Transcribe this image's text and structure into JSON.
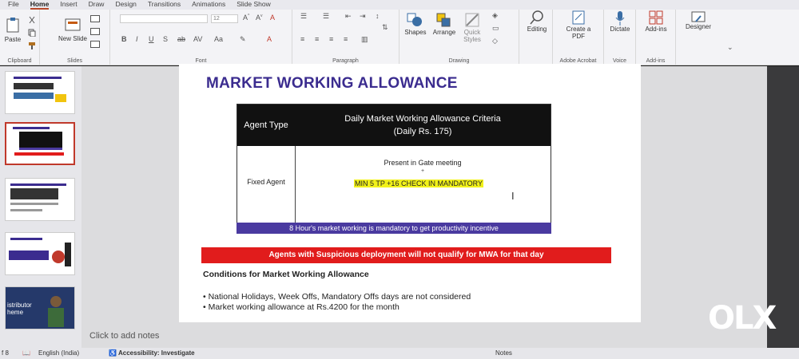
{
  "menu_tabs": [
    "File",
    "Home",
    "Insert",
    "Draw",
    "Design",
    "Transitions",
    "Animations",
    "Slide Show"
  ],
  "ribbon": {
    "paste": "Paste",
    "new_slide": "New Slide",
    "font_size": "12",
    "shapes": "Shapes",
    "arrange": "Arrange",
    "quick_styles": "Quick Styles",
    "editing": "Editing",
    "create_pdf": "Create a PDF",
    "dictate": "Dictate",
    "add_ins": "Add-ins",
    "designer": "Designer",
    "groups": {
      "clipboard": "Clipboard",
      "slides": "Slides",
      "font": "Font",
      "paragraph": "Paragraph",
      "drawing": "Drawing",
      "adobe": "Adobe Acrobat",
      "voice": "Voice",
      "addins": "Add-ins"
    }
  },
  "thumbnail_texts": {
    "slide5_lines": [
      "istributor",
      "heme"
    ]
  },
  "slide": {
    "title": "MARKET WORKING ALLOWANCE",
    "table": {
      "col1_header": "Agent Type",
      "col2_header_line1": "Daily Market Working Allowance Criteria",
      "col2_header_line2": "(Daily Rs. 175)",
      "row_label": "Fixed Agent",
      "criteria_1": "Present in Gate meeting",
      "plus": "+",
      "criteria_2": "MIN 5 TP +16 CHECK IN MANDATORY"
    },
    "footer_bar": "8 Hour's market working is mandatory to get productivity incentive",
    "warning": "Agents with Suspicious deployment will not qualify for MWA for that day",
    "conditions_title": "Conditions for Market Working Allowance",
    "bullets": [
      "• National Holidays, Week Offs, Mandatory Offs days are not considered",
      "• Market working allowance at Rs.4200 for the month"
    ]
  },
  "notes_placeholder": "Click to add notes",
  "status": {
    "slide": "f 8",
    "language": "English (India)",
    "accessibility": "Accessibility: Investigate",
    "notes": "Notes"
  },
  "watermark": "OLX",
  "colors": {
    "title": "#3b2c8f",
    "purple_bar": "#4a3aa0",
    "red_bar": "#e11c1c",
    "highlight": "#f2f21a"
  }
}
